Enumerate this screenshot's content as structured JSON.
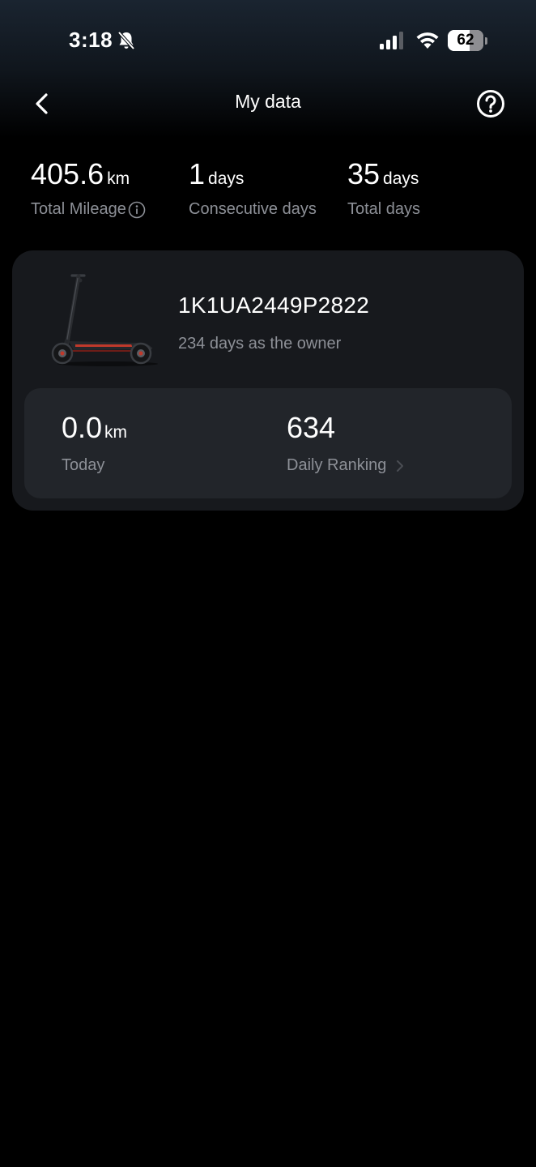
{
  "status_bar": {
    "time": "3:18",
    "battery_level": "62",
    "battery_fraction": 0.62,
    "icons": [
      "bell-slash-icon",
      "cellular-signal-icon",
      "wifi-icon",
      "battery-icon"
    ]
  },
  "nav": {
    "title": "My data",
    "back_icon": "chevron-left-icon",
    "help_icon": "question-circle-icon"
  },
  "stats": {
    "total_mileage": {
      "value": "405.6",
      "unit": "km",
      "label": "Total Mileage"
    },
    "consecutive_days": {
      "value": "1",
      "unit": "days",
      "label": "Consecutive days"
    },
    "total_days": {
      "value": "35",
      "unit": "days",
      "label": "Total days"
    }
  },
  "vehicle": {
    "serial": "1K1UA2449P2822",
    "ownership": "234 days as the owner",
    "today": {
      "value": "0.0",
      "unit": "km",
      "label": "Today"
    },
    "daily_ranking": {
      "value": "634",
      "label": "Daily Ranking"
    }
  },
  "colors": {
    "background": "#000000",
    "card": "#17191d",
    "panel": "#22252a",
    "secondary_text": "#8d9097",
    "scooter_accent": "#c0392b"
  }
}
